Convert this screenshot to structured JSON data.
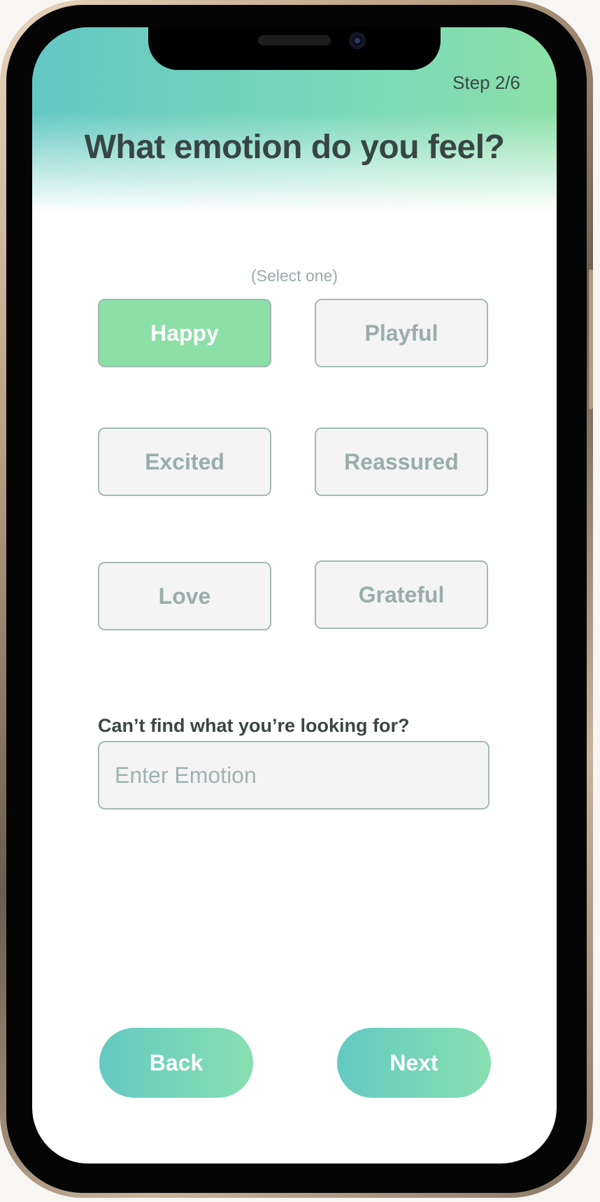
{
  "header": {
    "step": "Step 2/6",
    "title": "What emotion do you feel?"
  },
  "selection": {
    "hint": "(Select one)",
    "selected": "Happy",
    "options": [
      "Happy",
      "Playful",
      "Excited",
      "Reassured",
      "Love",
      "Grateful"
    ]
  },
  "custom": {
    "label": "Can’t find what you’re looking for?",
    "placeholder": "Enter Emotion",
    "value": ""
  },
  "nav": {
    "back_label": "Back",
    "next_label": "Next"
  },
  "colors": {
    "accent": "#8bdfa7",
    "gradient_start": "#64c9c2",
    "gradient_end": "#88dfb0",
    "text_dark": "#374645",
    "text_muted": "#99adab"
  }
}
